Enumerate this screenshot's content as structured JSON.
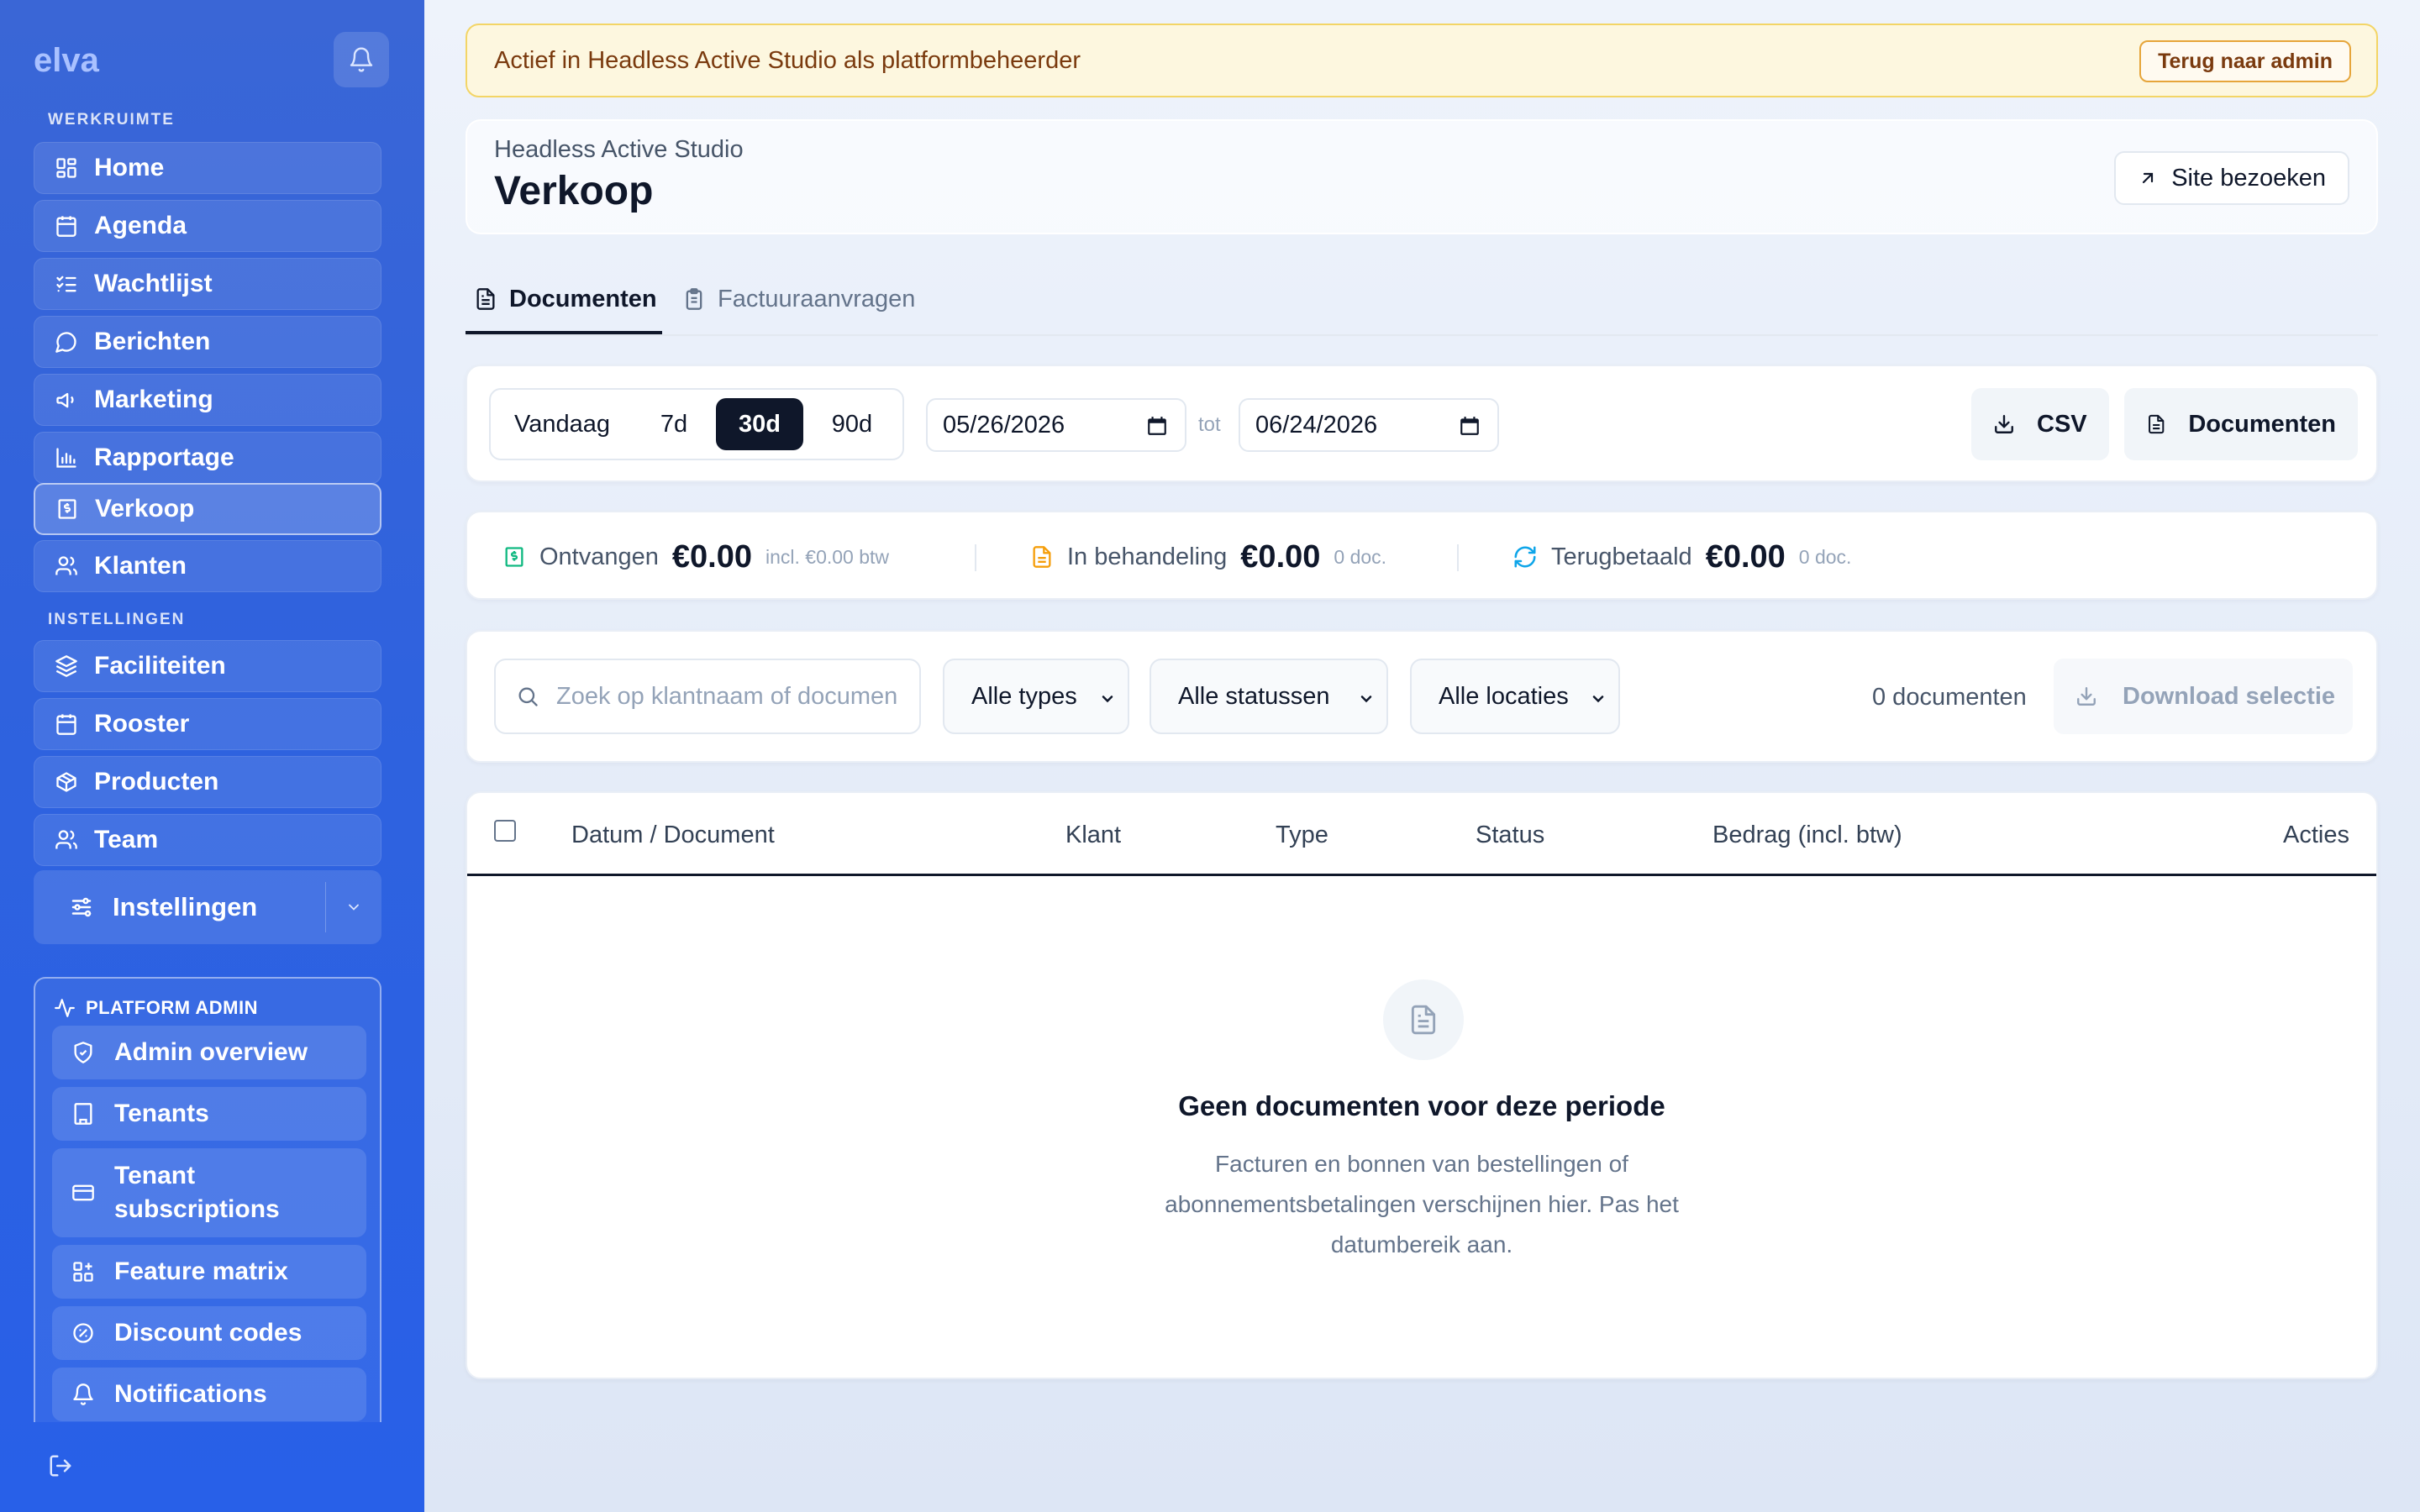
{
  "sidebar": {
    "brand": "elva",
    "section_workspace": "WERKRUIMTE",
    "workspace_items": [
      {
        "label": "Home",
        "icon": "dashboard-icon"
      },
      {
        "label": "Agenda",
        "icon": "calendar-icon"
      },
      {
        "label": "Wachtlijst",
        "icon": "checklist-icon"
      },
      {
        "label": "Berichten",
        "icon": "message-icon"
      },
      {
        "label": "Marketing",
        "icon": "megaphone-icon"
      },
      {
        "label": "Rapportage",
        "icon": "bar-chart-icon"
      },
      {
        "label": "Verkoop",
        "icon": "receipt-icon",
        "active": true
      },
      {
        "label": "Klanten",
        "icon": "users-icon"
      }
    ],
    "section_settings": "INSTELLINGEN",
    "settings_items": [
      {
        "label": "Faciliteiten",
        "icon": "layers-icon"
      },
      {
        "label": "Rooster",
        "icon": "calendar-icon"
      },
      {
        "label": "Producten",
        "icon": "package-icon"
      },
      {
        "label": "Team",
        "icon": "users-icon"
      }
    ],
    "instellingen_label": "Instellingen",
    "platform_admin": {
      "title": "PLATFORM ADMIN",
      "items": [
        {
          "label": "Admin overview",
          "icon": "shield-icon"
        },
        {
          "label": "Tenants",
          "icon": "building-icon"
        },
        {
          "label": "Tenant subscriptions",
          "label_line1": "Tenant",
          "label_line2": "subscriptions",
          "icon": "credit-card-icon"
        },
        {
          "label": "Feature matrix",
          "icon": "grid-plus-icon"
        },
        {
          "label": "Discount codes",
          "icon": "badge-percent-icon"
        },
        {
          "label": "Notifications",
          "icon": "bell-icon"
        }
      ]
    }
  },
  "banner": {
    "text": "Actief in Headless Active Studio als platformbeheerder",
    "button": "Terug naar admin"
  },
  "header": {
    "subtitle": "Headless Active Studio",
    "title": "Verkoop",
    "visit_button": "Site bezoeken"
  },
  "tabs": [
    {
      "label": "Documenten",
      "active": true
    },
    {
      "label": "Factuuraanvragen",
      "active": false
    }
  ],
  "filters": {
    "ranges": [
      "Vandaag",
      "7d",
      "30d",
      "90d"
    ],
    "active_range": "30d",
    "date_from": "05/26/2026",
    "date_to": "06/24/2026",
    "to_label": "tot",
    "csv_button": "CSV",
    "documents_button": "Documenten"
  },
  "stats": [
    {
      "label": "Ontvangen",
      "value": "€0.00",
      "note": "incl. €0.00 btw",
      "color": "#10b981"
    },
    {
      "label": "In behandeling",
      "value": "€0.00",
      "note": "0 doc.",
      "color": "#f59e0b"
    },
    {
      "label": "Terugbetaald",
      "value": "€0.00",
      "note": "0 doc.",
      "color": "#0ea5e9"
    }
  ],
  "search": {
    "placeholder": "Zoek op klantnaam of documen",
    "type_select": "Alle types",
    "status_select": "Alle statussen",
    "location_select": "Alle locaties",
    "count": "0 documenten",
    "download_button": "Download selectie"
  },
  "table": {
    "columns": [
      "Datum / Document",
      "Klant",
      "Type",
      "Status",
      "Bedrag (incl. btw)",
      "Acties"
    ],
    "empty_title": "Geen documenten voor deze periode",
    "empty_line1": "Facturen en bonnen van bestellingen of",
    "empty_line2": "abonnementsbetalingen verschijnen hier. Pas het",
    "empty_line3": "datumbereik aan."
  },
  "colors": {
    "sidebar": "#2f62de",
    "banner_bg": "#fdf7df",
    "banner_border": "#f3d566",
    "active_range": "#0f172a"
  }
}
